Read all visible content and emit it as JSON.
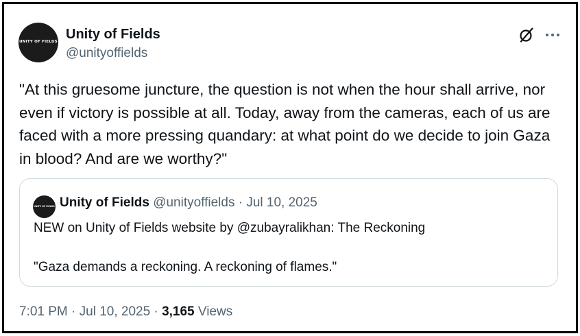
{
  "author": {
    "display_name": "Unity of Fields",
    "handle": "@unityoffields",
    "avatar_text": "UNITY OF FIELDS"
  },
  "header": {
    "grok_icon": "grok-slash-icon",
    "more_icon": "more-dots-icon"
  },
  "tweet": {
    "text": "\"At this gruesome juncture, the question is not when the hour shall arrive, nor even if victory is possible at all. Today, away from the cameras, each of us are faced with a more pressing quandary: at what point do we decide to join Gaza in blood? And are we worthy?\""
  },
  "quote": {
    "display_name": "Unity of Fields",
    "meta": "@unityoffields · Jul 10, 2025",
    "avatar_text": "UNITY OF FIELDS",
    "text_line1": "NEW on Unity of Fields website by @zubayralikhan: The Reckoning",
    "text_line2": "\"Gaza demands a reckoning. A reckoning of flames.\""
  },
  "footer": {
    "timestamp": "7:01 PM · Jul 10, 2025 · ",
    "views_count": "3,165",
    "views_label": "Views"
  },
  "colors": {
    "text_primary": "#0f1419",
    "text_secondary": "#536471",
    "border": "#cfd9de",
    "frame": "#000000"
  }
}
